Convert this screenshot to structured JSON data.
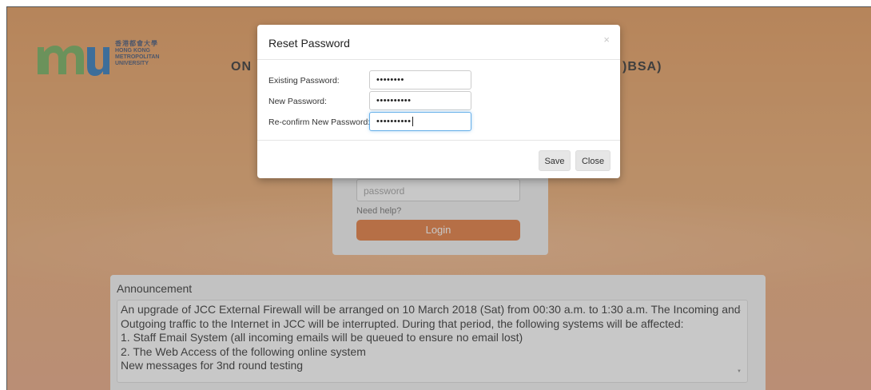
{
  "logo": {
    "mark": "mu",
    "chinese": "香港都會大學",
    "english_lines": [
      "HONG KONG",
      "METROPOLITAN",
      "UNIVERSITY"
    ]
  },
  "page": {
    "title_left": "ON",
    "title_right": ")BSA)"
  },
  "login": {
    "password_placeholder": "password",
    "need_help": "Need help?",
    "login_button": "Login"
  },
  "announcement": {
    "title": "Announcement",
    "lines": [
      "An upgrade of JCC External Firewall will be arranged on 10 March 2018 (Sat) from 00:30 a.m. to 1:30 a.m. The Incoming and",
      "Outgoing traffic to the Internet in JCC will be interrupted. During that period, the following systems will be affected:",
      "1. Staff Email System (all incoming emails will be queued to ensure no email lost)",
      "2. The Web Access of the following online system",
      "New messages for 3nd round testing"
    ]
  },
  "modal": {
    "title": "Reset Password",
    "close_glyph": "×",
    "fields": [
      {
        "label": "Existing Password:",
        "value": "••••••••"
      },
      {
        "label": "New Password:",
        "value": "••••••••••"
      },
      {
        "label": "Re-confirm New Password:",
        "value": "••••••••••"
      }
    ],
    "save_label": "Save",
    "close_label": "Close"
  },
  "colors": {
    "brand_green": "#6aa84f",
    "brand_blue": "#1f6fb5",
    "login_orange": "#e2702e"
  }
}
